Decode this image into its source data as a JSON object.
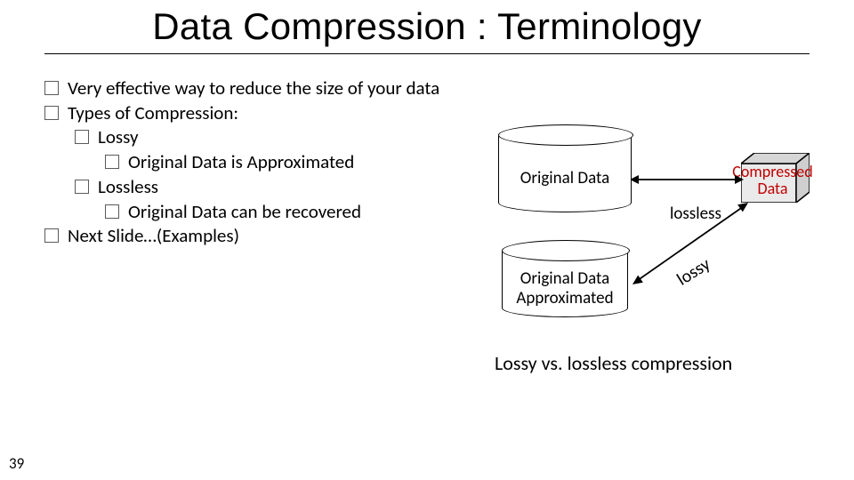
{
  "title": "Data Compression : Terminology",
  "bullets": {
    "b0": "Very effective way to reduce the size of your data",
    "b1": "Types of Compression:",
    "b1a": "Lossy",
    "b1a1": "Original Data is Approximated",
    "b1b": "Lossless",
    "b1b1": "Original Data can be recovered",
    "b2": "Next Slide…(Examples)"
  },
  "diagram": {
    "cyl_top": "Original Data",
    "cyl_bottom_l1": "Original Data",
    "cyl_bottom_l2": "Approximated",
    "cube_l1": "Compressed",
    "cube_l2": "Data",
    "lossless": "lossless",
    "lossy": "lossy"
  },
  "caption": "Lossy vs. lossless compression",
  "page": "39"
}
